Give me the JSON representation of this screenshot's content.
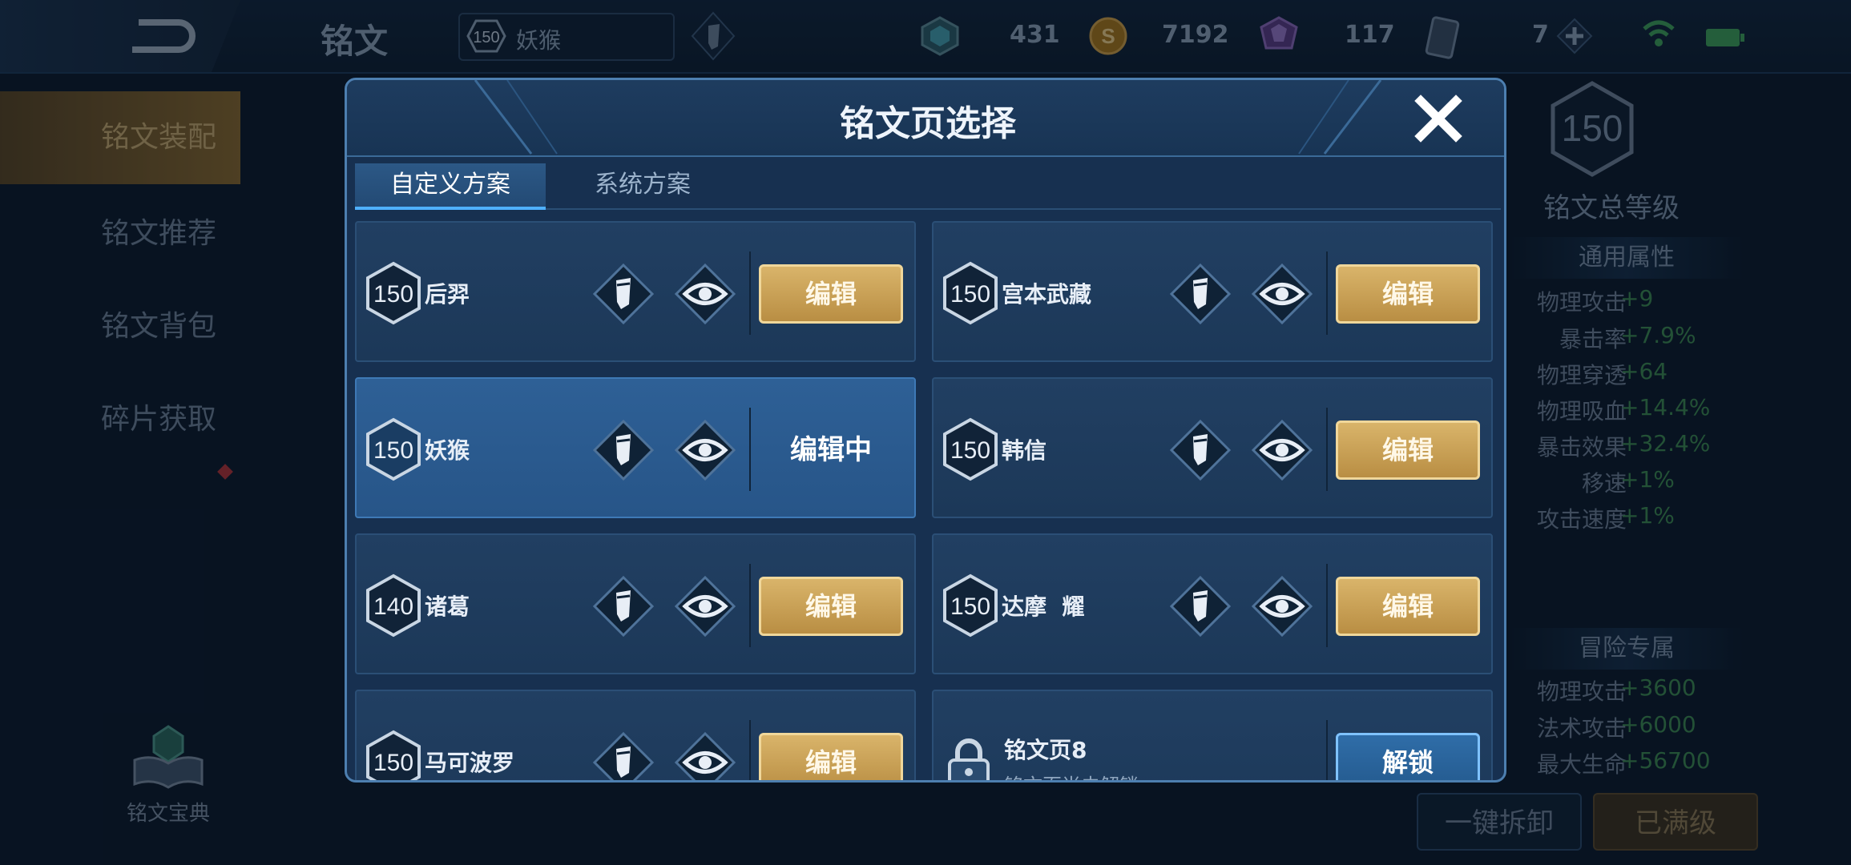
{
  "topbar": {
    "page_title": "铭文",
    "hero_level": "150",
    "hero_name": "妖猴",
    "currencies": [
      {
        "icon": "gem-box-icon",
        "value": "431"
      },
      {
        "icon": "gold-coin-icon",
        "value": "7192"
      },
      {
        "icon": "purple-crystal-icon",
        "value": "117"
      },
      {
        "icon": "card-ticket-icon",
        "value": "7"
      }
    ]
  },
  "left_nav": {
    "items": [
      "铭文装配",
      "铭文推荐",
      "铭文背包",
      "碎片获取"
    ],
    "active_index": 0,
    "codex_label": "铭文宝典"
  },
  "right_panel": {
    "total_level": "150",
    "total_label": "铭文总等级",
    "general_header": "通用属性",
    "general_attrs": [
      {
        "name": "物理攻击",
        "value": "+9"
      },
      {
        "name": "暴击率",
        "value": "+7.9%"
      },
      {
        "name": "物理穿透",
        "value": "+64"
      },
      {
        "name": "物理吸血",
        "value": "+14.4%"
      },
      {
        "name": "暴击效果",
        "value": "+32.4%"
      },
      {
        "name": "移速",
        "value": "+1%"
      },
      {
        "name": "攻击速度",
        "value": "+1%"
      }
    ],
    "adventure_header": "冒险专属",
    "adventure_attrs": [
      {
        "name": "物理攻击",
        "value": "+3600"
      },
      {
        "name": "法术攻击",
        "value": "+6000"
      },
      {
        "name": "最大生命",
        "value": "+56700"
      }
    ],
    "unload_button": "一键拆卸",
    "maxed_button": "已满级"
  },
  "modal": {
    "title": "铭文页选择",
    "tabs": [
      "自定义方案",
      "系统方案"
    ],
    "active_tab": 0,
    "edit_label": "编辑",
    "editing_label": "编辑中",
    "unlock_label": "解锁",
    "pages": [
      {
        "level": "150",
        "hero": "后羿",
        "state": "edit"
      },
      {
        "level": "150",
        "hero": "宫本武藏",
        "state": "edit"
      },
      {
        "level": "150",
        "hero": "妖猴",
        "state": "editing"
      },
      {
        "level": "150",
        "hero": "韩信",
        "state": "edit"
      },
      {
        "level": "140",
        "hero": "诸葛",
        "state": "edit"
      },
      {
        "level": "150",
        "hero": "达摩  耀",
        "state": "edit"
      },
      {
        "level": "150",
        "hero": "马可波罗",
        "state": "edit"
      },
      {
        "level": "",
        "hero": "铭文页8",
        "state": "locked",
        "sub": "铭文页尚未解锁"
      }
    ]
  },
  "colors": {
    "gold_button": "#c9a052",
    "modal_bg": "#173050",
    "accent_blue": "#4fb0ff",
    "attr_green": "#3d8a52"
  }
}
